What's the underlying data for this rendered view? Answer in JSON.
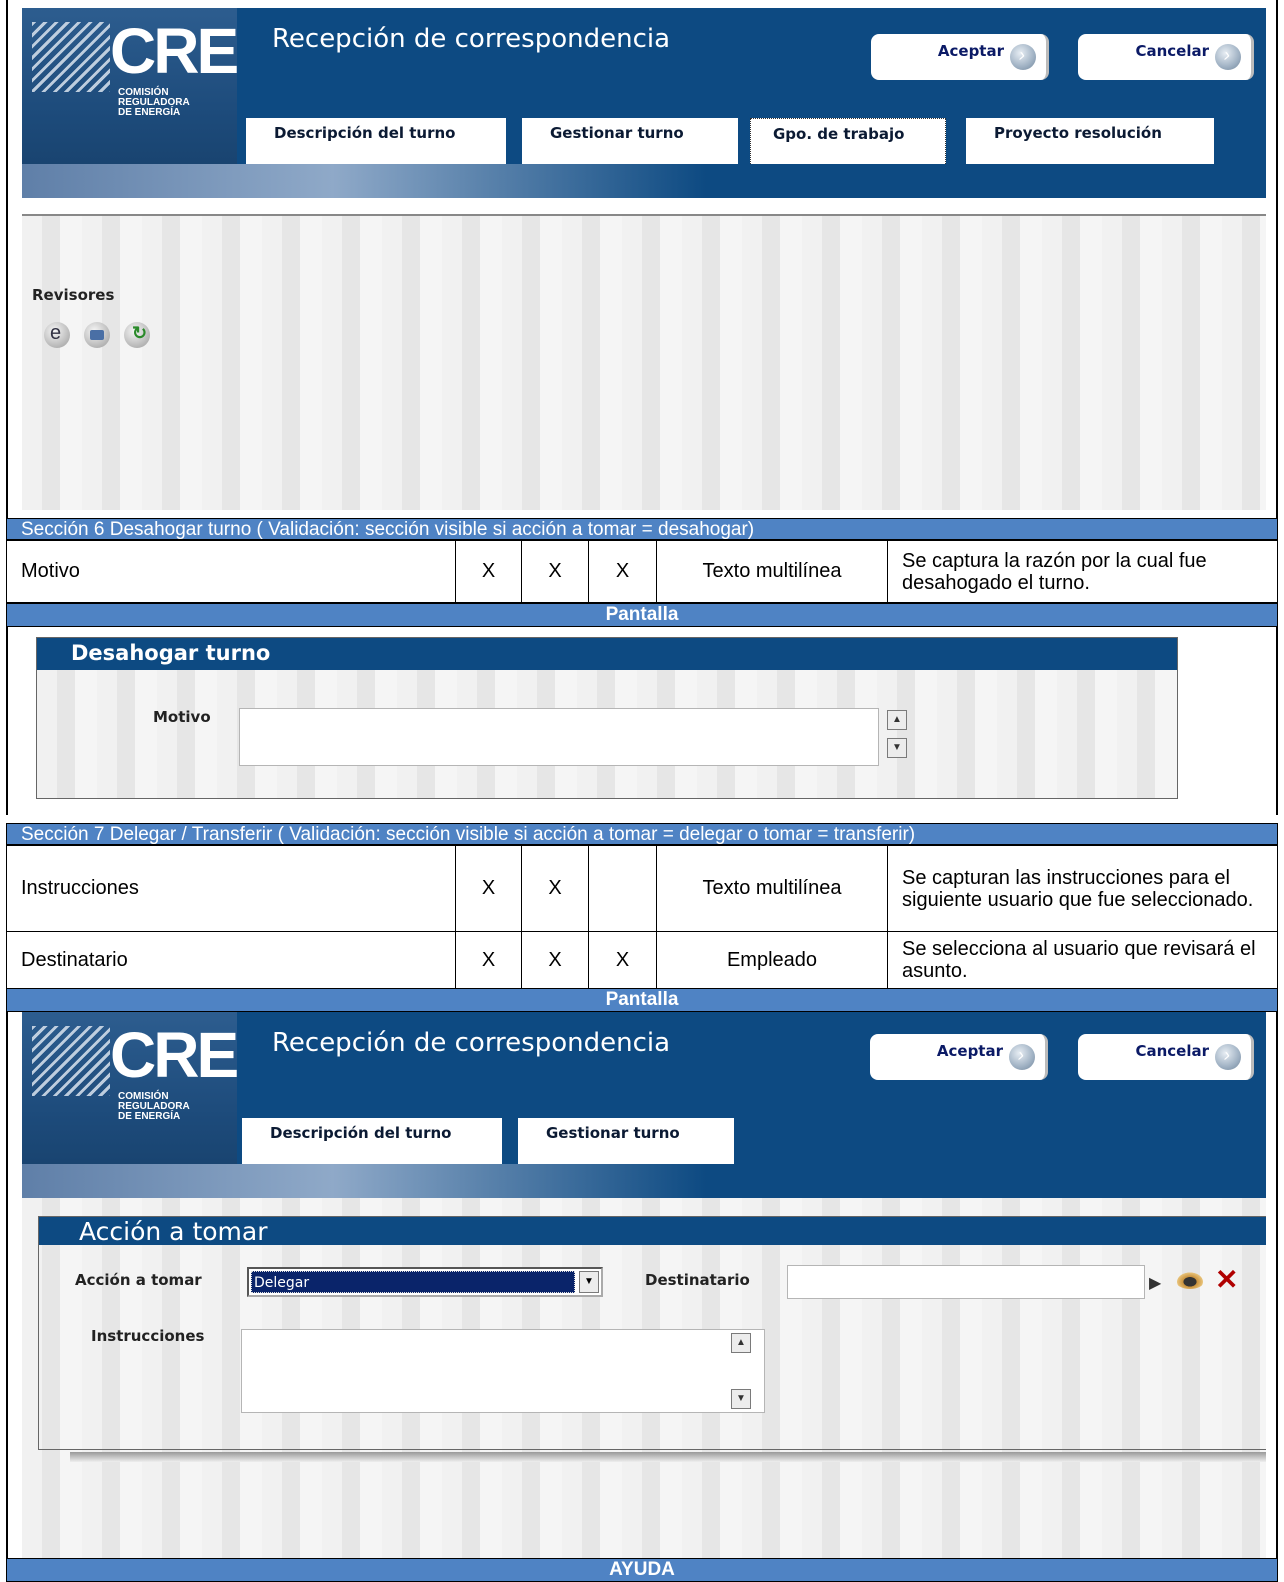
{
  "app": {
    "logo_text": "CRE",
    "logo_sub": [
      "COMISIÓN",
      "REGULADORA",
      "DE ENERGÍA"
    ],
    "title": "Recepción de correspondencia",
    "accept_label": "Aceptar",
    "cancel_label": "Cancelar"
  },
  "screen1": {
    "tabs": [
      "Descripción del turno",
      "Gestionar turno",
      "Gpo. de trabajo",
      "Proyecto resolución"
    ],
    "revisores_label": "Revisores"
  },
  "section6": {
    "title": "Sección 6 Desahogar turno ( Validación: sección visible si acción a tomar = desahogar)",
    "rows": [
      {
        "field": "Motivo",
        "c1": "X",
        "c2": "X",
        "c3": "X",
        "type": "Texto multilínea",
        "desc": "Se captura la razón por la cual fue desahogado el turno."
      }
    ],
    "pantalla_label": "Pantalla",
    "panel_title": "Desahogar turno",
    "motivo_label": "Motivo"
  },
  "section7": {
    "title": "Sección 7 Delegar / Transferir ( Validación: sección visible si acción a tomar = delegar o tomar = transferir)",
    "rows": [
      {
        "field": "Instrucciones",
        "c1": "X",
        "c2": "X",
        "c3": "",
        "type": "Texto multilínea",
        "desc": "Se capturan las instrucciones para el siguiente usuario que fue seleccionado."
      },
      {
        "field": "Destinatario",
        "c1": "X",
        "c2": "X",
        "c3": "X",
        "type": "Empleado",
        "desc": "Se selecciona al usuario que revisará el asunto."
      }
    ],
    "pantalla_label": "Pantalla"
  },
  "screen2": {
    "tabs": [
      "Descripción del turno",
      "Gestionar turno"
    ],
    "panel_title": "Acción a tomar",
    "accion_label": "Acción a tomar",
    "accion_value": "Delegar",
    "destinatario_label": "Destinatario",
    "destinatario_value": "",
    "instrucciones_label": "Instrucciones"
  },
  "ayuda_label": "AYUDA",
  "colors": {
    "header_blue": "#0d4a82",
    "bar_blue": "#4f83c4"
  },
  "icons": [
    "ie-icon",
    "print-icon",
    "refresh-icon",
    "search-arrow-icon",
    "eye-icon",
    "close-icon",
    "scroll-up-icon",
    "scroll-down-icon",
    "dropdown-arrow-icon",
    "play-circle-icon"
  ]
}
